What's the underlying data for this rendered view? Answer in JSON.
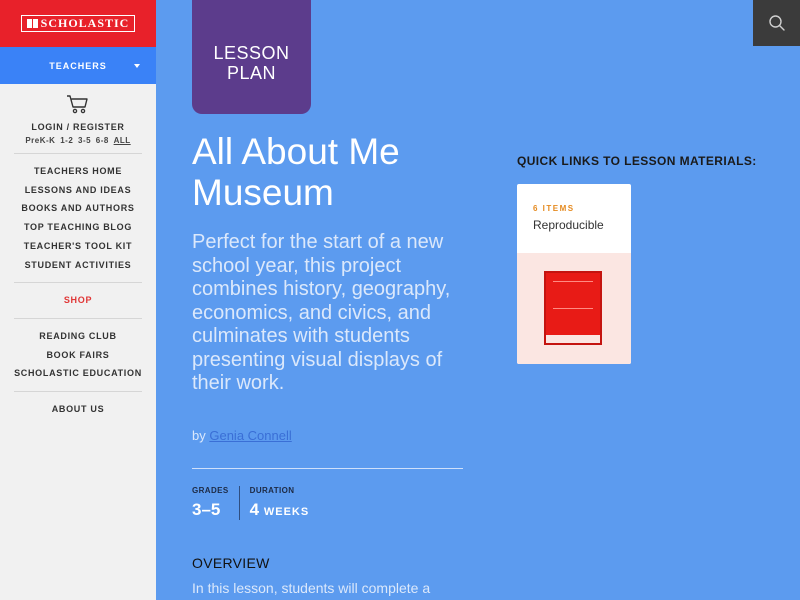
{
  "brand": {
    "logo_text": "SCHOLASTIC"
  },
  "sidebar": {
    "audience": "TEACHERS",
    "login": "LOGIN / REGISTER",
    "grades": [
      "PreK-K",
      "1-2",
      "3-5",
      "6-8",
      "ALL"
    ],
    "nav_group_1": [
      "TEACHERS HOME",
      "LESSONS AND IDEAS",
      "BOOKS AND AUTHORS",
      "TOP TEACHING BLOG",
      "TEACHER'S TOOL KIT",
      "STUDENT ACTIVITIES"
    ],
    "shop": "SHOP",
    "nav_group_2": [
      "READING CLUB",
      "BOOK FAIRS",
      "SCHOLASTIC EDUCATION"
    ],
    "about": "ABOUT US"
  },
  "header": {
    "search_icon": "search-icon"
  },
  "lesson": {
    "badge_line1": "LESSON",
    "badge_line2": "PLAN",
    "title_line1": "All About Me",
    "title_line2": "Museum",
    "description": "Perfect for the start of a new school year, this project combines history, geography, economics, and civics, and culminates with students presenting visual displays of their work.",
    "by": "by",
    "author": "Genia Connell",
    "grades_label": "GRADES",
    "grades_value": "3–5",
    "duration_label": "DURATION",
    "duration_num": "4",
    "duration_unit": "WEEKS",
    "overview_heading": "OVERVIEW",
    "overview_text": "In this lesson, students will complete a"
  },
  "quick_links": {
    "heading": "QUICK LINKS TO LESSON MATERIALS:",
    "card_count": "6 ITEMS",
    "card_type": "Reproducible"
  },
  "colors": {
    "page_bg": "#5c9bef",
    "sidebar_bg": "#f1f1f1",
    "logo_red": "#e8212a",
    "teachers_blue": "#3a82f7",
    "badge_purple": "#5c3c8c",
    "search_bg": "#3b3b3b"
  }
}
